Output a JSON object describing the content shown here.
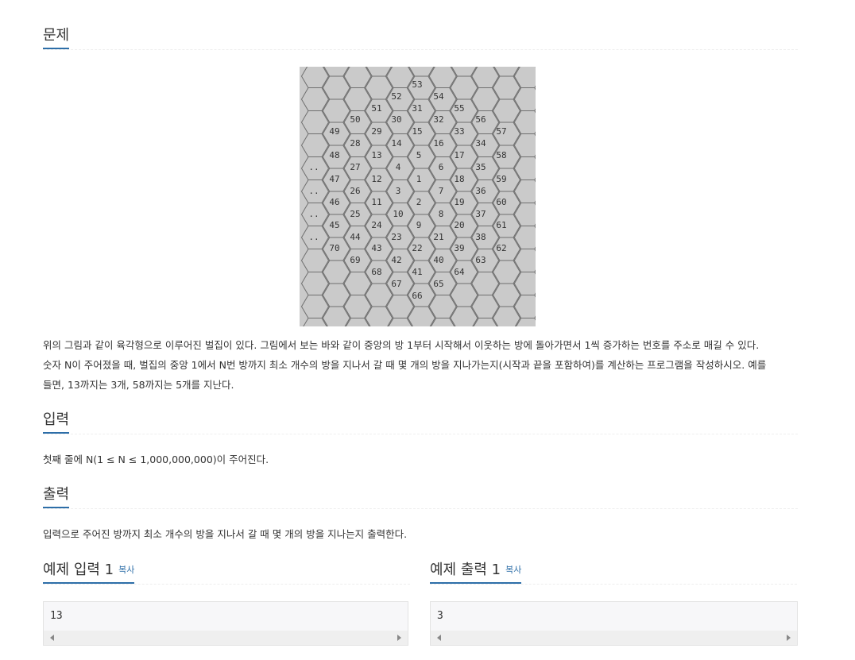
{
  "problem": {
    "title": "문제",
    "paragraph_lines": [
      "위의 그림과 같이 육각형으로 이루어진 벌집이 있다. 그림에서 보는 바와 같이 중앙의 방 1부터 시작해서 이웃하는 방에 돌아가면서 1씩 증가하는 번호를 주소로 매길 수 있다.",
      "숫자 N이 주어졌을 때, 벌집의 중앙 1에서 N번 방까지 최소 개수의 방을 지나서 갈 때 몇 개의 방을 지나가는지(시작과 끝을 포함하여)를 계산하는 프로그램을 작성하시오. 예를",
      "들면, 13까지는 3개, 58까지는 5개를 지난다."
    ],
    "figure": {
      "background": "#cacaca",
      "labels": [
        "53",
        "52",
        "54",
        "51",
        "31",
        "55",
        "50",
        "30",
        "32",
        "56",
        "49",
        "29",
        "15",
        "33",
        "57",
        "28",
        "14",
        "16",
        "34",
        "48",
        "13",
        "5",
        "17",
        "58",
        "..",
        "27",
        "4",
        "6",
        "35",
        "47",
        "12",
        "1",
        "18",
        "59",
        "..",
        "26",
        "3",
        "7",
        "36",
        "46",
        "11",
        "2",
        "19",
        "60",
        "..",
        "25",
        "10",
        "8",
        "37",
        "45",
        "24",
        "9",
        "20",
        "61",
        "..",
        "44",
        "23",
        "21",
        "38",
        "70",
        "43",
        "22",
        "39",
        "62",
        "69",
        "42",
        "40",
        "63",
        "68",
        "41",
        "64",
        "67",
        "65",
        "66"
      ]
    }
  },
  "input": {
    "title": "입력",
    "text": "첫째 줄에 N(1 ≤ N ≤ 1,000,000,000)이 주어진다."
  },
  "output": {
    "title": "출력",
    "text": "입력으로 주어진 방까지 최소 개수의 방을 지나서 갈 때 몇 개의 방을 지나는지 출력한다."
  },
  "sample_input": {
    "title": "예제 입력 1",
    "copy_label": "복사",
    "value": "13"
  },
  "sample_output": {
    "title": "예제 출력 1",
    "copy_label": "복사",
    "value": "3"
  },
  "colors": {
    "accent": "#2d6ea8",
    "figure_bg": "#cacaca"
  }
}
